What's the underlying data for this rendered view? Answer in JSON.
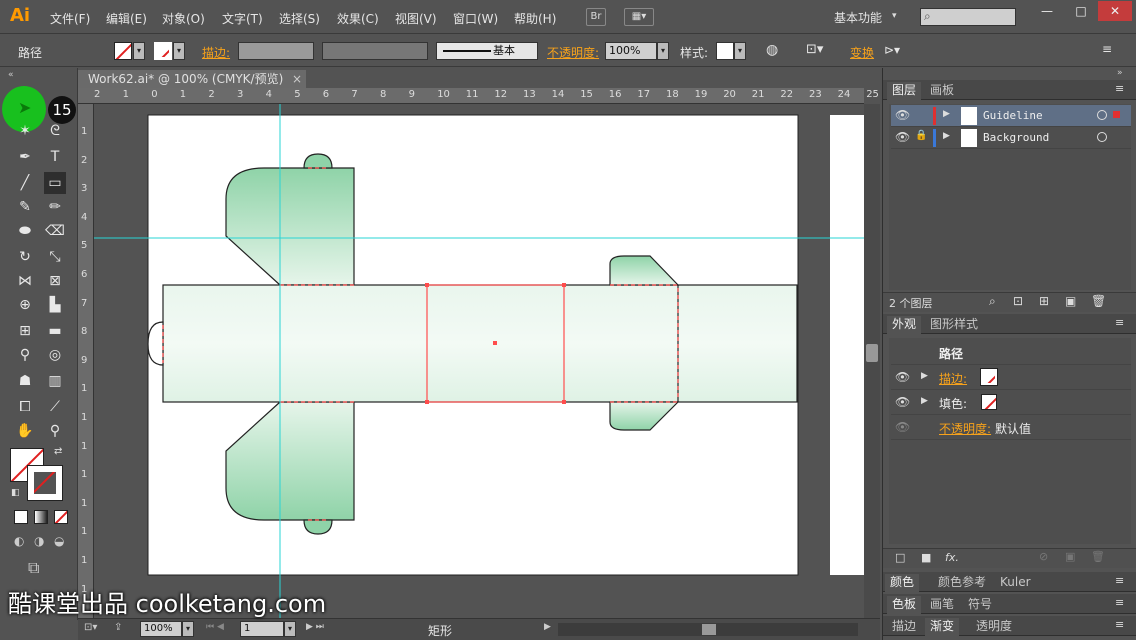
{
  "app": {
    "logo": "Ai"
  },
  "menu": [
    "文件(F)",
    "编辑(E)",
    "对象(O)",
    "文字(T)",
    "选择(S)",
    "效果(C)",
    "视图(V)",
    "窗口(W)",
    "帮助(H)"
  ],
  "bridge_button": "Br",
  "workspace": "基本功能",
  "window_controls": [
    "—",
    "□",
    "✕"
  ],
  "control_bar": {
    "object_type": "路径",
    "stroke_label": "描边:",
    "stroke_style": "基本",
    "opacity_label": "不透明度:",
    "opacity_value": "100%",
    "style_label": "样式:",
    "transform_label": "变换"
  },
  "document_tab": "Work62.ai* @ 100% (CMYK/预览)",
  "document_tab_close": "×",
  "tutorial_step": "15",
  "ruler_top_labels": [
    "2",
    "1",
    "0",
    "1",
    "2",
    "3",
    "4",
    "5",
    "6",
    "7",
    "8",
    "9",
    "10",
    "11",
    "12",
    "13",
    "14",
    "15",
    "16",
    "17",
    "18",
    "19",
    "20",
    "21",
    "22",
    "23",
    "24",
    "25"
  ],
  "ruler_left_labels": [
    "1",
    "2",
    "3",
    "4",
    "5",
    "6",
    "7",
    "8",
    "9",
    "1",
    "1",
    "1",
    "1",
    "1",
    "1",
    "1",
    "1"
  ],
  "status_bar": {
    "zoom": "100%",
    "page": "1",
    "tool_name": "矩形"
  },
  "layers_panel": {
    "tabs": [
      "图层",
      "画板"
    ],
    "layers": [
      {
        "name": "Guideline",
        "color": "#e03030",
        "selected": true,
        "locked": false
      },
      {
        "name": "Background",
        "color": "#3a78d8",
        "selected": false,
        "locked": true
      }
    ],
    "count": "2 个图层"
  },
  "appearance_panel": {
    "tabs": [
      "外观",
      "图形样式"
    ],
    "title": "路径",
    "stroke_label": "描边:",
    "fill_label": "填色:",
    "opacity_label": "不透明度:",
    "opacity_value": "默认值",
    "fx": "fx."
  },
  "bottom_tabs": [
    [
      "颜色",
      "颜色参考",
      "Kuler"
    ],
    [
      "色板",
      "画笔",
      "符号"
    ],
    [
      "描边",
      "渐变",
      "透明度"
    ]
  ],
  "watermark": "酷课堂出品 coolketang.com",
  "colors": {
    "accent_orange": "#f7a21b",
    "guide": "#29d4d4",
    "selection": "#ff4d4d",
    "shape_fill": "#8fd3a8"
  }
}
